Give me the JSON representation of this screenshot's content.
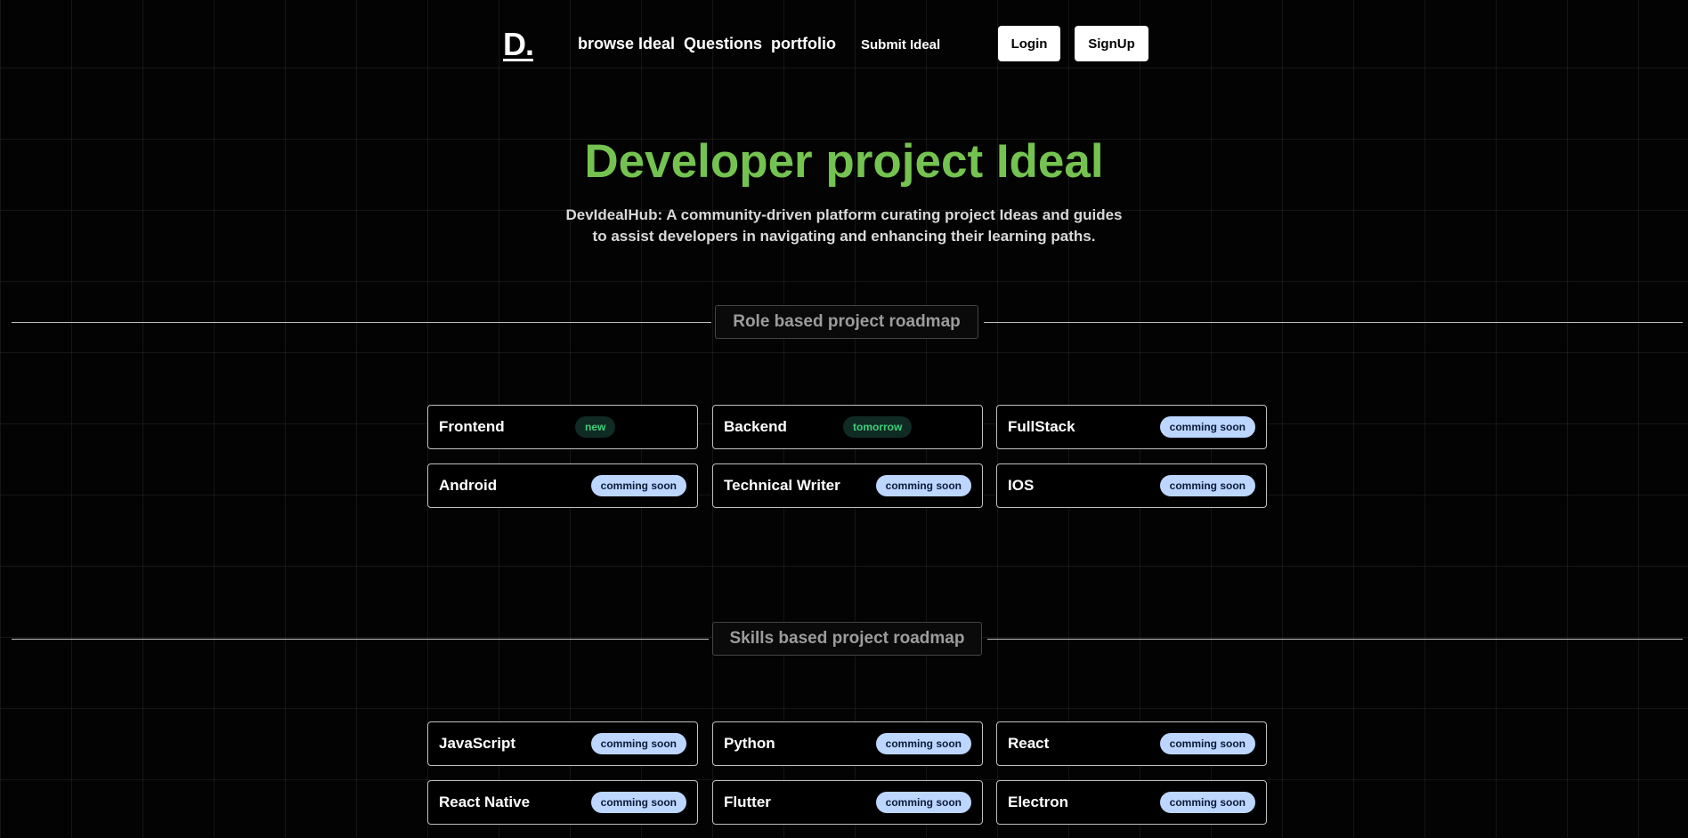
{
  "nav": {
    "logo": "D.",
    "links": [
      "browse Ideal",
      "Questions",
      "portfolio",
      "Submit Ideal"
    ],
    "login": "Login",
    "signup": "SignUp"
  },
  "hero": {
    "title": "Developer project Ideal",
    "subtitle_line1": "DevIdealHub: A community-driven platform curating project Ideas and guides",
    "subtitle_line2": "to assist developers in navigating and enhancing their learning paths."
  },
  "role_section": {
    "label": "Role based project roadmap",
    "cards": [
      {
        "title": "Frontend",
        "badge": "new"
      },
      {
        "title": "Backend",
        "badge": "tomorrow"
      },
      {
        "title": "FullStack",
        "badge": "comming soon"
      },
      {
        "title": "Android",
        "badge": "comming soon"
      },
      {
        "title": "Technical Writer",
        "badge": "comming soon"
      },
      {
        "title": "IOS",
        "badge": "comming soon"
      }
    ]
  },
  "skills_section": {
    "label": "Skills based project roadmap",
    "cards": [
      {
        "title": "JavaScript",
        "badge": "comming soon"
      },
      {
        "title": "Python",
        "badge": "comming soon"
      },
      {
        "title": "React",
        "badge": "comming soon"
      },
      {
        "title": "React Native",
        "badge": "comming soon"
      },
      {
        "title": "Flutter",
        "badge": "comming soon"
      },
      {
        "title": "Electron",
        "badge": "comming soon"
      }
    ]
  },
  "colors": {
    "accent_green": "#74c350",
    "badge_soon_bg": "#bcd6ff",
    "badge_new_text": "#3fcf7a",
    "background": "#030303"
  }
}
